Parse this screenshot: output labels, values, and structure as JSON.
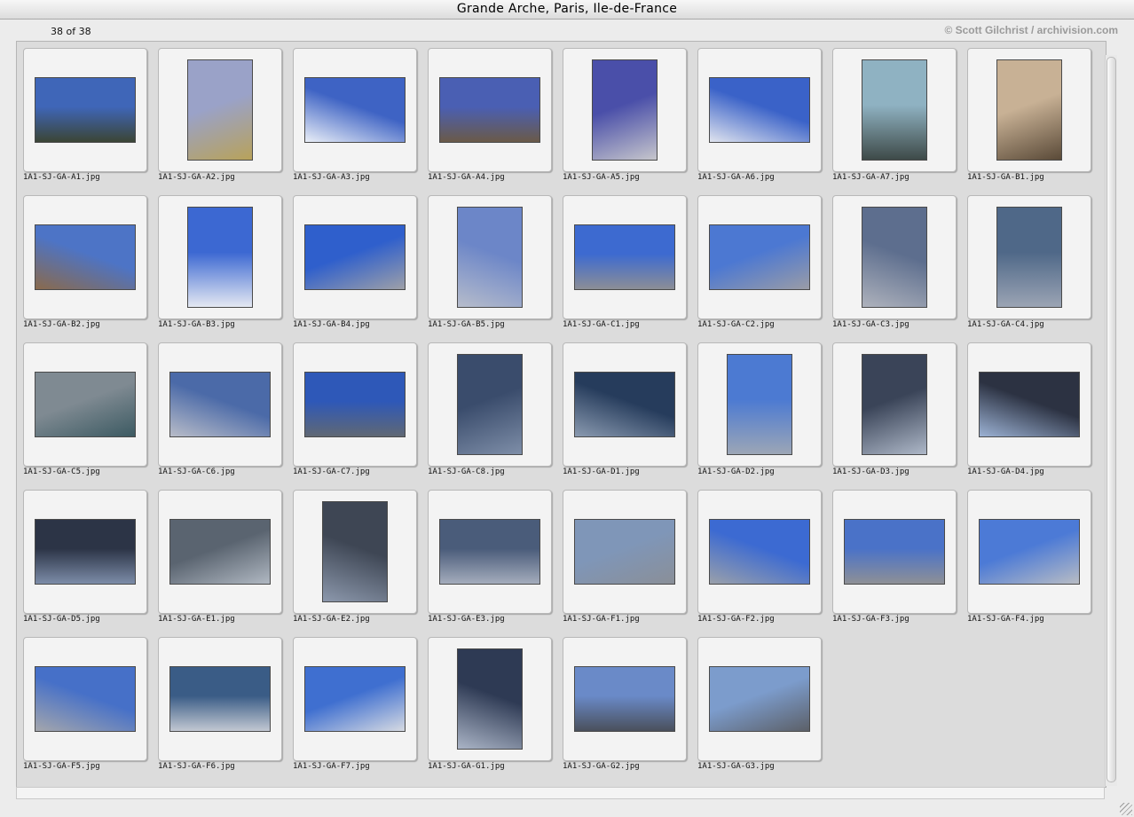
{
  "window": {
    "title": "Grande Arche, Paris, Ile-de-France"
  },
  "header": {
    "count": "38 of 38",
    "credit": "© Scott Gilchrist / archivision.com"
  },
  "photos": [
    {
      "file": "1A1-SJ-GA-A1.jpg",
      "o": "l",
      "c": "#3f66b8",
      "c2": "#3b4535"
    },
    {
      "file": "1A1-SJ-GA-A2.jpg",
      "o": "p",
      "c": "#9aa2c8",
      "c2": "#b8a25a"
    },
    {
      "file": "1A1-SJ-GA-A3.jpg",
      "o": "l",
      "c": "#3e63c4",
      "c2": "#e9eef7"
    },
    {
      "file": "1A1-SJ-GA-A4.jpg",
      "o": "l",
      "c": "#4a5fb3",
      "c2": "#6a5a48"
    },
    {
      "file": "1A1-SJ-GA-A5.jpg",
      "o": "p",
      "c": "#4a4fa9",
      "c2": "#c6c6cc"
    },
    {
      "file": "1A1-SJ-GA-A6.jpg",
      "o": "l",
      "c": "#3a62c8",
      "c2": "#dfe3ee"
    },
    {
      "file": "1A1-SJ-GA-A7.jpg",
      "o": "p",
      "c": "#8fb2c2",
      "c2": "#3e4a48"
    },
    {
      "file": "1A1-SJ-GA-B1.jpg",
      "o": "p",
      "c": "#c8b195",
      "c2": "#5a4a38"
    },
    {
      "file": "1A1-SJ-GA-B2.jpg",
      "o": "l",
      "c": "#4d74c6",
      "c2": "#8a6a4c"
    },
    {
      "file": "1A1-SJ-GA-B3.jpg",
      "o": "p",
      "c": "#3c68d2",
      "c2": "#e4e8f2"
    },
    {
      "file": "1A1-SJ-GA-B4.jpg",
      "o": "l",
      "c": "#2f5fcc",
      "c2": "#9ea0a8"
    },
    {
      "file": "1A1-SJ-GA-B5.jpg",
      "o": "p",
      "c": "#6c86c8",
      "c2": "#b6bccb"
    },
    {
      "file": "1A1-SJ-GA-C1.jpg",
      "o": "l",
      "c": "#3d6ad0",
      "c2": "#8c8e96"
    },
    {
      "file": "1A1-SJ-GA-C2.jpg",
      "o": "l",
      "c": "#4c78d2",
      "c2": "#9a9ca6"
    },
    {
      "file": "1A1-SJ-GA-C3.jpg",
      "o": "p",
      "c": "#5d6e8e",
      "c2": "#aeb2bc"
    },
    {
      "file": "1A1-SJ-GA-C4.jpg",
      "o": "p",
      "c": "#4f6888",
      "c2": "#9ba4b4"
    },
    {
      "file": "1A1-SJ-GA-C5.jpg",
      "o": "l",
      "c": "#7f8a92",
      "c2": "#3c5a62"
    },
    {
      "file": "1A1-SJ-GA-C6.jpg",
      "o": "l",
      "c": "#4b6aa8",
      "c2": "#b8bcc8"
    },
    {
      "file": "1A1-SJ-GA-C7.jpg",
      "o": "l",
      "c": "#2e58b8",
      "c2": "#606874"
    },
    {
      "file": "1A1-SJ-GA-C8.jpg",
      "o": "p",
      "c": "#3a4c6c",
      "c2": "#7e8ea8"
    },
    {
      "file": "1A1-SJ-GA-D1.jpg",
      "o": "l",
      "c": "#263c5c",
      "c2": "#8a9ab0"
    },
    {
      "file": "1A1-SJ-GA-D2.jpg",
      "o": "p",
      "c": "#4c7ad2",
      "c2": "#9ca6b6"
    },
    {
      "file": "1A1-SJ-GA-D3.jpg",
      "o": "p",
      "c": "#3a4458",
      "c2": "#aeb8c8"
    },
    {
      "file": "1A1-SJ-GA-D4.jpg",
      "o": "l",
      "c": "#2c3242",
      "c2": "#9cb2d4"
    },
    {
      "file": "1A1-SJ-GA-D5.jpg",
      "o": "l",
      "c": "#2c3446",
      "c2": "#7c8ca8"
    },
    {
      "file": "1A1-SJ-GA-E1.jpg",
      "o": "l",
      "c": "#5a6470",
      "c2": "#b0b8c2"
    },
    {
      "file": "1A1-SJ-GA-E2.jpg",
      "o": "p",
      "c": "#3e4654",
      "c2": "#8c98ac"
    },
    {
      "file": "1A1-SJ-GA-E3.jpg",
      "o": "l",
      "c": "#4a5c7a",
      "c2": "#a4acbc"
    },
    {
      "file": "1A1-SJ-GA-F1.jpg",
      "o": "l",
      "c": "#7f96b8",
      "c2": "#8a8f98"
    },
    {
      "file": "1A1-SJ-GA-F2.jpg",
      "o": "l",
      "c": "#3c6ad2",
      "c2": "#9aa0aa"
    },
    {
      "file": "1A1-SJ-GA-F3.jpg",
      "o": "l",
      "c": "#4a72c8",
      "c2": "#8e9096"
    },
    {
      "file": "1A1-SJ-GA-F4.jpg",
      "o": "l",
      "c": "#4c7ad6",
      "c2": "#b8bcc4"
    },
    {
      "file": "1A1-SJ-GA-F5.jpg",
      "o": "l",
      "c": "#4670c8",
      "c2": "#a4a6ac"
    },
    {
      "file": "1A1-SJ-GA-F6.jpg",
      "o": "l",
      "c": "#3a5c86",
      "c2": "#c2c8d2"
    },
    {
      "file": "1A1-SJ-GA-F7.jpg",
      "o": "l",
      "c": "#3f6fd0",
      "c2": "#d6dae2"
    },
    {
      "file": "1A1-SJ-GA-G1.jpg",
      "o": "p",
      "c": "#2e3a54",
      "c2": "#aab4c6"
    },
    {
      "file": "1A1-SJ-GA-G2.jpg",
      "o": "l",
      "c": "#6a8ac8",
      "c2": "#4a505c"
    },
    {
      "file": "1A1-SJ-GA-G3.jpg",
      "o": "l",
      "c": "#7c9ccc",
      "c2": "#5c6068"
    }
  ]
}
